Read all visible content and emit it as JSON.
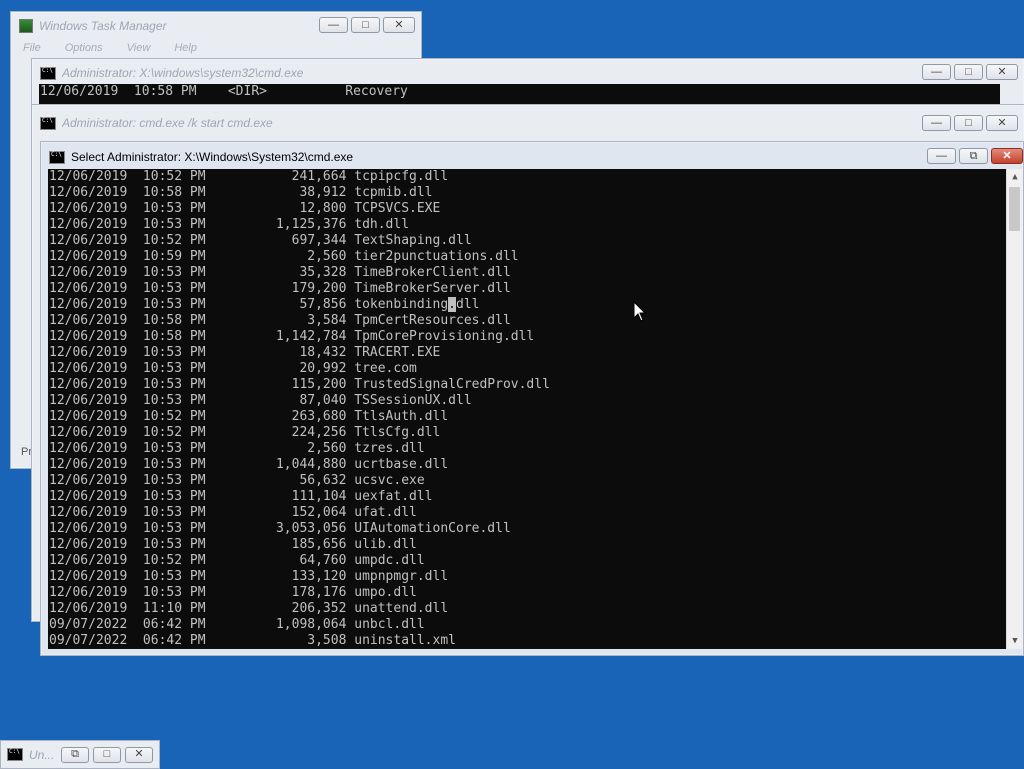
{
  "task_manager": {
    "title": "Windows Task Manager",
    "menu": [
      "File",
      "Options",
      "View",
      "Help"
    ],
    "side_text": "Pr"
  },
  "cmd_back": {
    "title": "Administrator: X:\\windows\\system32\\cmd.exe",
    "line": "12/06/2019  10:58 PM    <DIR>          Recovery"
  },
  "cmd_mid": {
    "title": "Administrator: cmd.exe /k start cmd.exe"
  },
  "cmd_front": {
    "title": "Select Administrator: X:\\Windows\\System32\\cmd.exe",
    "caret_line_index": 8,
    "lines": [
      "12/06/2019  10:52 PM           241,664 tcpipcfg.dll",
      "12/06/2019  10:58 PM            38,912 tcpmib.dll",
      "12/06/2019  10:53 PM            12,800 TCPSVCS.EXE",
      "12/06/2019  10:53 PM         1,125,376 tdh.dll",
      "12/06/2019  10:52 PM           697,344 TextShaping.dll",
      "12/06/2019  10:59 PM             2,560 tier2punctuations.dll",
      "12/06/2019  10:53 PM            35,328 TimeBrokerClient.dll",
      "12/06/2019  10:53 PM           179,200 TimeBrokerServer.dll",
      "12/06/2019  10:53 PM            57,856 tokenbinding.dll",
      "12/06/2019  10:58 PM             3,584 TpmCertResources.dll",
      "12/06/2019  10:58 PM         1,142,784 TpmCoreProvisioning.dll",
      "12/06/2019  10:53 PM            18,432 TRACERT.EXE",
      "12/06/2019  10:53 PM            20,992 tree.com",
      "12/06/2019  10:53 PM           115,200 TrustedSignalCredProv.dll",
      "12/06/2019  10:53 PM            87,040 TSSessionUX.dll",
      "12/06/2019  10:52 PM           263,680 TtlsAuth.dll",
      "12/06/2019  10:52 PM           224,256 TtlsCfg.dll",
      "12/06/2019  10:53 PM             2,560 tzres.dll",
      "12/06/2019  10:53 PM         1,044,880 ucrtbase.dll",
      "12/06/2019  10:53 PM            56,632 ucsvc.exe",
      "12/06/2019  10:53 PM           111,104 uexfat.dll",
      "12/06/2019  10:53 PM           152,064 ufat.dll",
      "12/06/2019  10:53 PM         3,053,056 UIAutomationCore.dll",
      "12/06/2019  10:53 PM           185,656 ulib.dll",
      "12/06/2019  10:52 PM            64,760 umpdc.dll",
      "12/06/2019  10:53 PM           133,120 umpnpmgr.dll",
      "12/06/2019  10:53 PM           178,176 umpo.dll",
      "12/06/2019  11:10 PM           206,352 unattend.dll",
      "09/07/2022  06:42 PM         1,098,064 unbcl.dll",
      "09/07/2022  06:42 PM             3,508 uninstall.xml"
    ]
  },
  "taskbar_item": {
    "title": "Un..."
  },
  "icons": {
    "minimize": "minimize-icon",
    "maximize": "maximize-icon",
    "restore": "restore-icon",
    "close": "close-icon"
  }
}
